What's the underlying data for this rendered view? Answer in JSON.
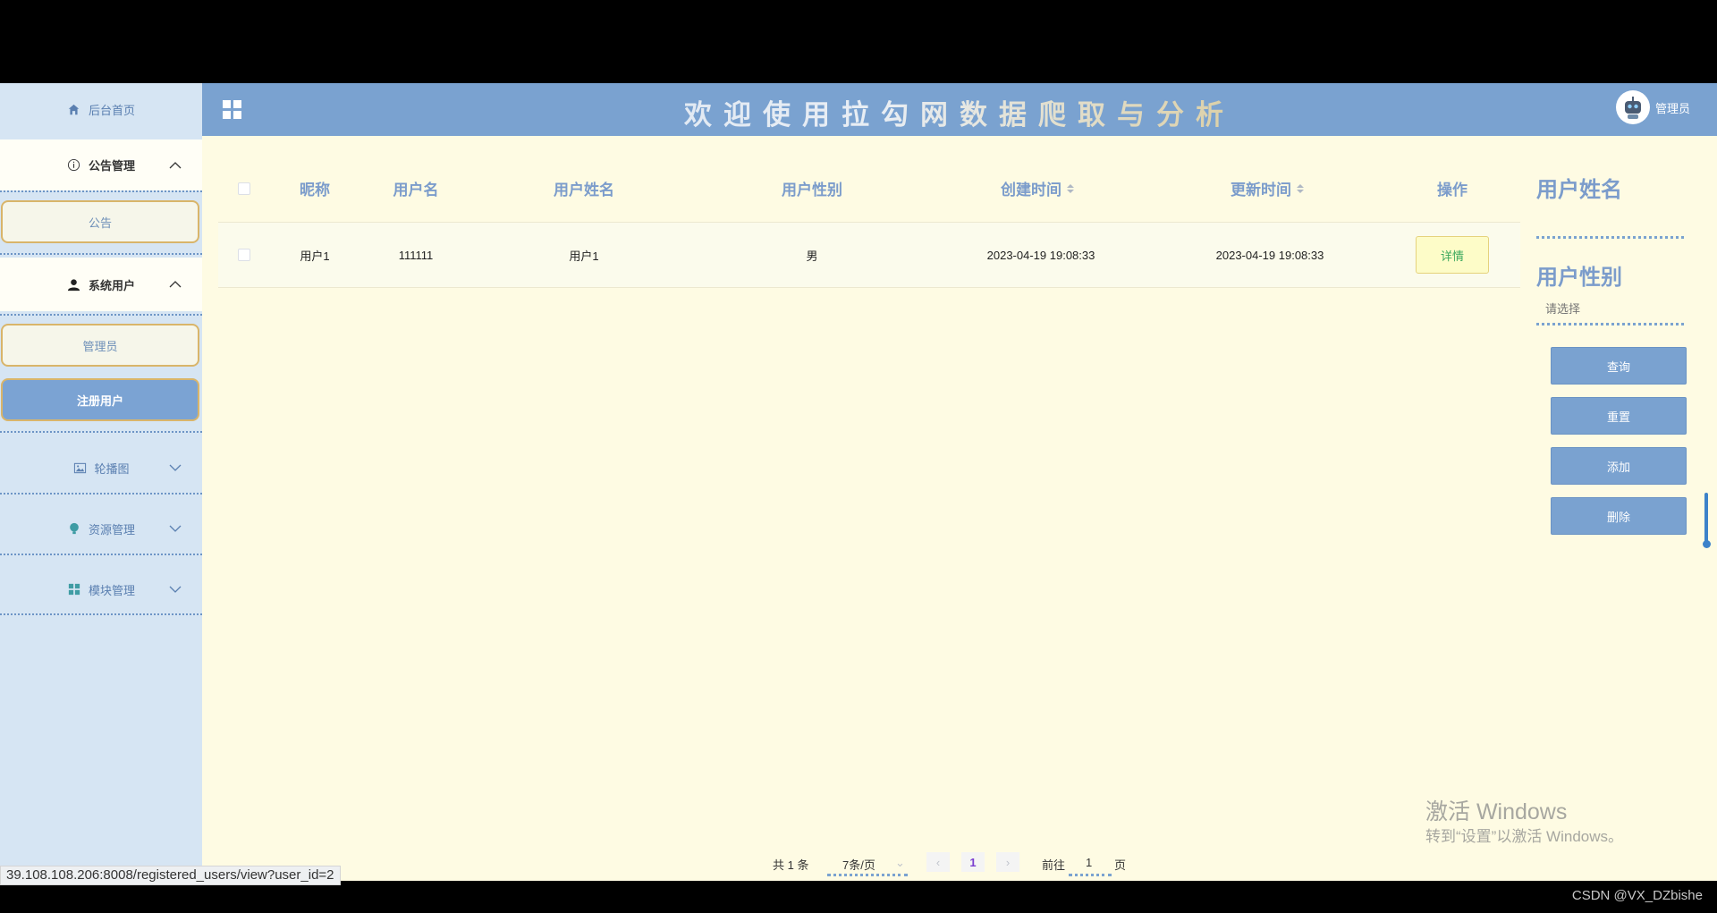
{
  "sidebar": {
    "home": "后台首页",
    "notice_group": "公告管理",
    "notice_item": "公告",
    "users_group": "系统用户",
    "admin_item": "管理员",
    "registered_item": "注册用户",
    "carousel": "轮播图",
    "resources": "资源管理",
    "modules": "模块管理"
  },
  "header": {
    "title": "欢迎使用拉勾网数据爬取与分析",
    "user": "管理员"
  },
  "table": {
    "headers": [
      "昵称",
      "用户名",
      "用户姓名",
      "用户性别",
      "创建时间",
      "更新时间",
      "操作"
    ],
    "rows": [
      {
        "nickname": "用户1",
        "username": "111111",
        "realname": "用户1",
        "gender": "男",
        "created": "2023-04-19 19:08:33",
        "updated": "2023-04-19 19:08:33",
        "action": "详情"
      }
    ]
  },
  "filters": {
    "name_label": "用户姓名",
    "gender_label": "用户性别",
    "gender_placeholder": "请选择",
    "query": "查询",
    "reset": "重置",
    "add": "添加",
    "delete": "删除"
  },
  "pagination": {
    "total": "共 1 条",
    "page_size": "7条/页",
    "current_page": "1",
    "goto_prefix": "前往",
    "goto_value": "1",
    "goto_suffix": "页"
  },
  "watermark": {
    "line1": "激活 Windows",
    "line2": "转到“设置”以激活 Windows。"
  },
  "status_url": "39.108.108.206:8008/registered_users/view?user_id=2",
  "credit": "CSDN @VX_DZbishe",
  "colors": {
    "accent": "#7aa2d0",
    "content_bg": "#fefbe3",
    "sidebar_bg": "#d6e5f3",
    "active_border": "#d9b56a"
  }
}
